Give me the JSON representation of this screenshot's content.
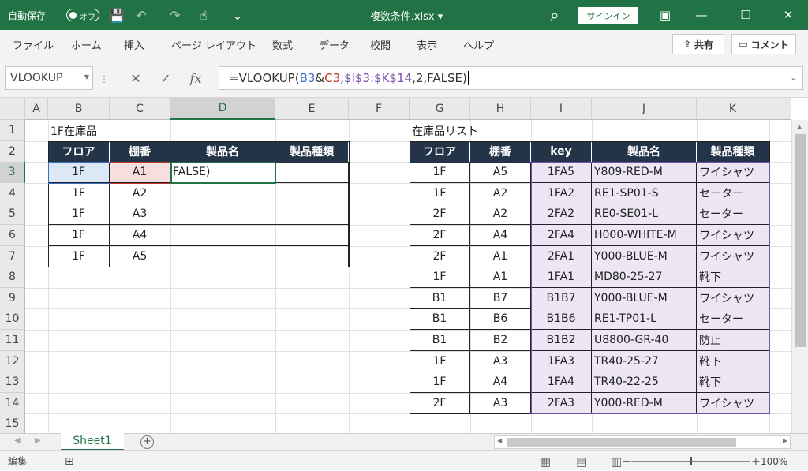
{
  "titlebar": {
    "autosave_label": "自動保存",
    "autosave_state": "オフ",
    "file_title": "複数条件.xlsx ▾",
    "signin_label": "サインイン",
    "save_icon": "💾",
    "undo_icon": "↶",
    "redo_icon": "↷",
    "touch_icon": "☝",
    "customize_icon": "⌄",
    "search_icon": "⌕",
    "ribbon_display_icon": "▣",
    "minimize_icon": "—",
    "maximize_icon": "☐",
    "close_icon": "✕",
    "accent_color": "#217346"
  },
  "ribbon": {
    "tabs": [
      "ファイル",
      "ホーム",
      "挿入",
      "ページ レイアウト",
      "数式",
      "データ",
      "校閲",
      "表示",
      "ヘルプ"
    ],
    "share_label": "共有",
    "comment_label": "コメント"
  },
  "formula_bar": {
    "name_box": "VLOOKUP",
    "cancel_icon": "✕",
    "enter_icon": "✓",
    "fx_icon": "fx",
    "formula_parts": [
      "=VLOOKUP(",
      "B3",
      "&",
      "C3",
      ",",
      "$I$3:$K$14",
      ",2,FALSE)"
    ]
  },
  "columns": [
    "A",
    "B",
    "C",
    "D",
    "E",
    "F",
    "G",
    "H",
    "I",
    "J",
    "K"
  ],
  "rows": [
    "1",
    "2",
    "3",
    "4",
    "5",
    "6",
    "7",
    "8",
    "9",
    "10",
    "11",
    "12",
    "13",
    "14",
    "15"
  ],
  "left_table": {
    "title": "1F在庫品",
    "headers": [
      "フロア",
      "棚番",
      "製品名",
      "製品種類"
    ],
    "rows": [
      [
        "1F",
        "A1",
        "FALSE)",
        ""
      ],
      [
        "1F",
        "A2",
        "",
        ""
      ],
      [
        "1F",
        "A3",
        "",
        ""
      ],
      [
        "1F",
        "A4",
        "",
        ""
      ],
      [
        "1F",
        "A5",
        "",
        ""
      ]
    ]
  },
  "right_table": {
    "title": "在庫品リスト",
    "headers": [
      "フロア",
      "棚番",
      "key",
      "製品名",
      "製品種類"
    ],
    "rows": [
      [
        "1F",
        "A5",
        "1FA5",
        "Y809-RED-M",
        "ワイシャツ"
      ],
      [
        "1F",
        "A2",
        "1FA2",
        "RE1-SP01-S",
        "セーター"
      ],
      [
        "2F",
        "A2",
        "2FA2",
        "RE0-SE01-L",
        "セーター"
      ],
      [
        "2F",
        "A4",
        "2FA4",
        "H000-WHITE-M",
        "ワイシャツ"
      ],
      [
        "2F",
        "A1",
        "2FA1",
        "Y000-BLUE-M",
        "ワイシャツ"
      ],
      [
        "1F",
        "A1",
        "1FA1",
        "MD80-25-27",
        "靴下"
      ],
      [
        "B1",
        "B7",
        "B1B7",
        "Y000-BLUE-M",
        "ワイシャツ"
      ],
      [
        "B1",
        "B6",
        "B1B6",
        "RE1-TP01-L",
        "セーター"
      ],
      [
        "B1",
        "B2",
        "B1B2",
        "U8800-GR-40",
        "防止"
      ],
      [
        "1F",
        "A3",
        "1FA3",
        "TR40-25-27",
        "靴下"
      ],
      [
        "1F",
        "A4",
        "1FA4",
        "TR40-22-25",
        "靴下"
      ],
      [
        "2F",
        "A3",
        "2FA3",
        "Y000-RED-M",
        "ワイシャツ"
      ]
    ]
  },
  "sheet_tabs": [
    "Sheet1"
  ],
  "status": {
    "mode": "編集",
    "zoom": "100%"
  },
  "colors": {
    "header_fill": "#243448",
    "range_purple": "#ece6f5",
    "ref_blue": "#dde8f7",
    "ref_red": "#f8dede"
  }
}
